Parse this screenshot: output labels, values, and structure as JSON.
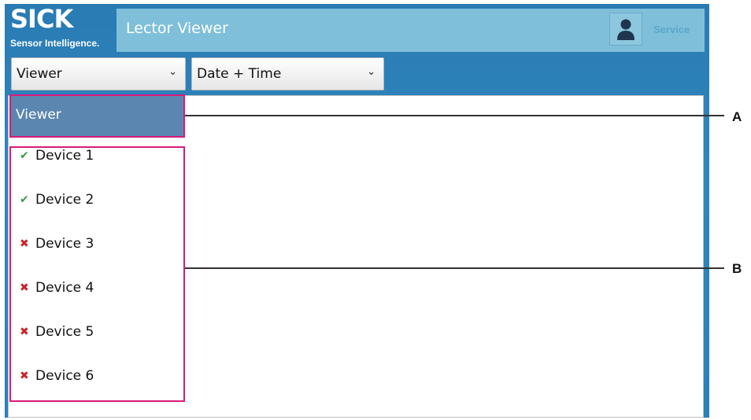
{
  "header": {
    "logo_word": "SICK",
    "logo_tagline": "Sensor Intelligence.",
    "app_title": "Lector Viewer",
    "user_role": "Service"
  },
  "toolbar": {
    "view_select_value": "Viewer",
    "sort_select_value": "Date + Time"
  },
  "sidebar": {
    "selected_item": "Viewer",
    "devices": [
      {
        "label": "Device 1",
        "status": "connected"
      },
      {
        "label": "Device 2",
        "status": "connected"
      },
      {
        "label": "Device 3",
        "status": "disconnected"
      },
      {
        "label": "Device 4",
        "status": "disconnected"
      },
      {
        "label": "Device 5",
        "status": "disconnected"
      },
      {
        "label": "Device 6",
        "status": "disconnected"
      }
    ]
  },
  "annotations": {
    "callout_a": "A",
    "callout_b": "B",
    "highlight_color": "#d81b7a"
  },
  "colors": {
    "header_blue": "#2a7bb3",
    "selected_item_bg": "#5b86b0",
    "ok_green": "#3a9a46",
    "error_red": "#c8242c"
  }
}
